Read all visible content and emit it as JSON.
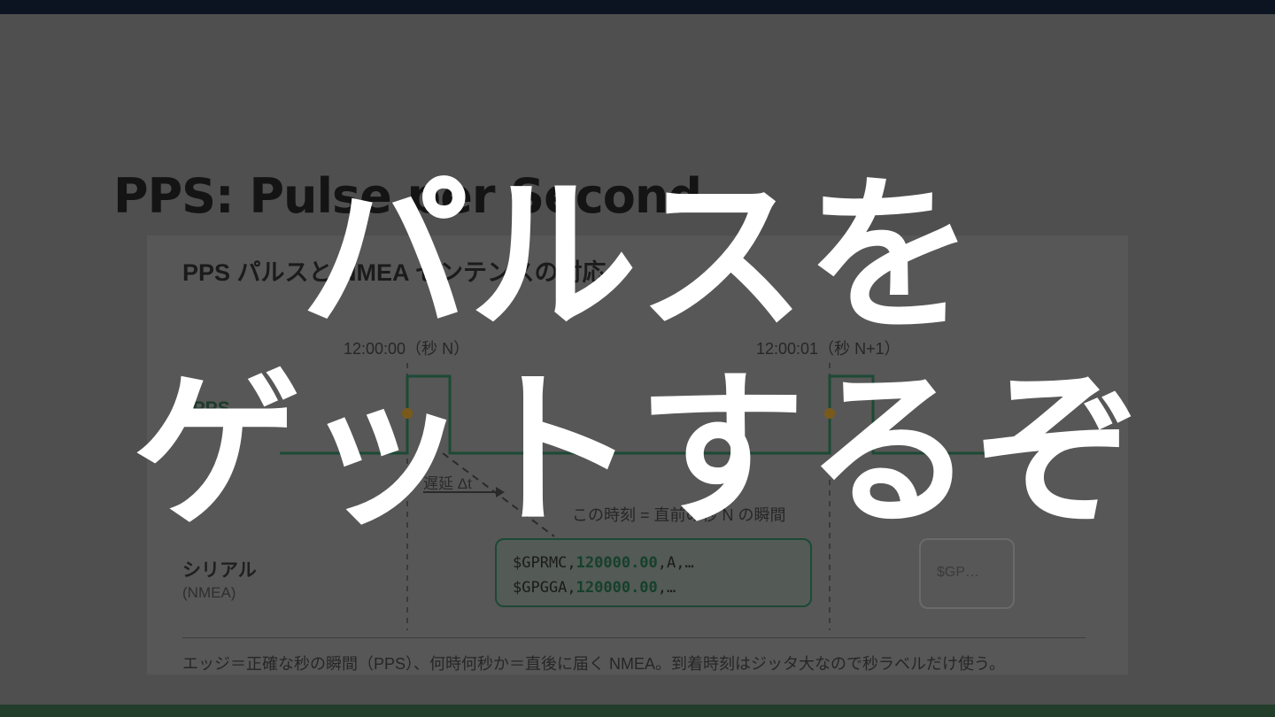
{
  "slide": {
    "title": "PPS: Pulse per Second"
  },
  "figure": {
    "heading": "PPS パルスと NMEA センテンスの対応",
    "time_n": "12:00:00（秒 N）",
    "time_n1": "12:00:01（秒 N+1）",
    "row_pps": "1PPS",
    "row_serial": "シリアル",
    "row_serial_sub": "(NMEA)",
    "delay": "遅延 Δt",
    "moment": "この時刻 = 直前の秒 N の瞬間",
    "nmea_lines": [
      {
        "prefix": "$GPRMC,",
        "time": "120000.00",
        "suffix": ",A,…"
      },
      {
        "prefix": "$GPGGA,",
        "time": "120000.00",
        "suffix": ",…"
      }
    ],
    "nmea_next": "$GP…",
    "caption": "エッジ＝正確な秒の瞬間（PPS）、何時何秒か＝直後に届く NMEA。到着時刻はジッタ大なので秒ラベルだけ使う。"
  },
  "overlay": {
    "line1": "パルスを",
    "line2": "ゲットするぞ"
  },
  "colors": {
    "background": "#4f4f4f",
    "top_bar": "#0b1420",
    "bottom_bar": "#223d2a",
    "signal": "#1c4a35",
    "edge_marker": "#7a5a1a",
    "overlay_text": "#ffffff"
  }
}
